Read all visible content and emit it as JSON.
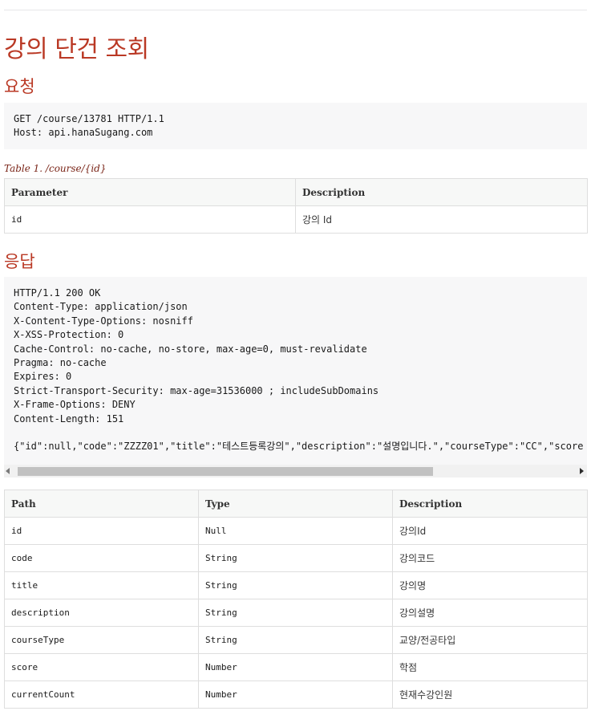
{
  "title": "강의 단건 조회",
  "request": {
    "heading": "요청",
    "code": "GET /course/13781 HTTP/1.1\nHost: api.hanaSugang.com"
  },
  "params_table": {
    "caption": "Table 1. /course/{id}",
    "headers": [
      "Parameter",
      "Description"
    ],
    "rows": [
      [
        "id",
        "강의 Id"
      ]
    ]
  },
  "response": {
    "heading": "응답",
    "code": "HTTP/1.1 200 OK\nContent-Type: application/json\nX-Content-Type-Options: nosniff\nX-XSS-Protection: 0\nCache-Control: no-cache, no-store, max-age=0, must-revalidate\nPragma: no-cache\nExpires: 0\nStrict-Transport-Security: max-age=31536000 ; includeSubDomains\nX-Frame-Options: DENY\nContent-Length: 151\n\n{\"id\":null,\"code\":\"ZZZZ01\",\"title\":\"테스트등록강의\",\"description\":\"설명입니다.\",\"courseType\":\"CC\",\"score"
  },
  "fields_table": {
    "headers": [
      "Path",
      "Type",
      "Description"
    ],
    "rows": [
      [
        "id",
        "Null",
        "강의Id"
      ],
      [
        "code",
        "String",
        "강의코드"
      ],
      [
        "title",
        "String",
        "강의명"
      ],
      [
        "description",
        "String",
        "강의설명"
      ],
      [
        "courseType",
        "String",
        "교양/전공타입"
      ],
      [
        "score",
        "Number",
        "학점"
      ],
      [
        "currentCount",
        "Number",
        "현재수강인원"
      ]
    ]
  }
}
